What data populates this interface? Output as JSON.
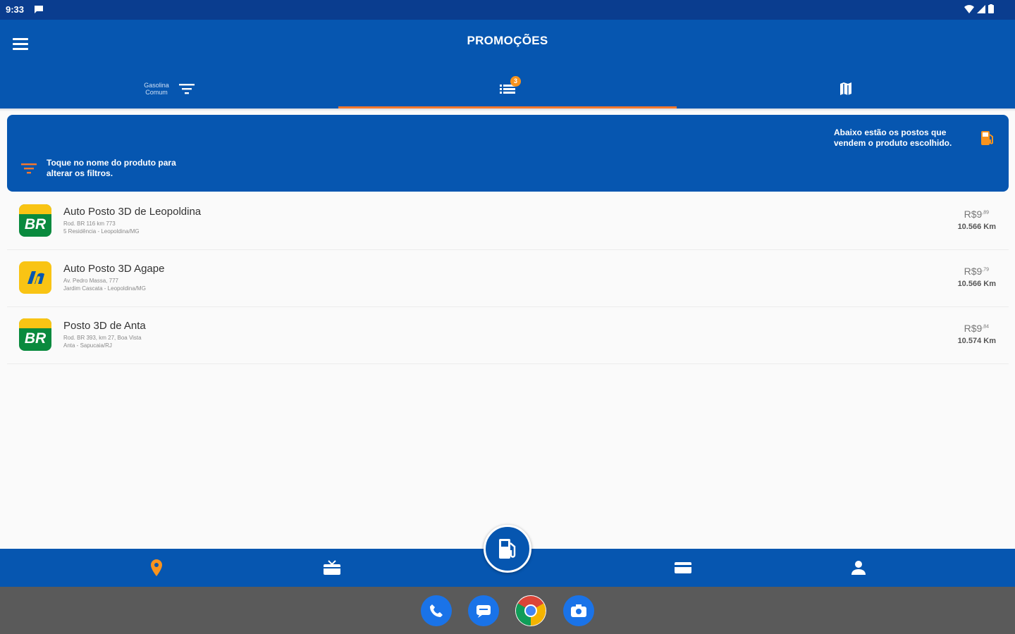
{
  "statusbar": {
    "time": "9:33"
  },
  "appbar": {
    "title": "PROMOÇÕES"
  },
  "tabs": {
    "fuel_filter_label_1": "Gasolina",
    "fuel_filter_label_2": "Comum",
    "badge_count": "3"
  },
  "info": {
    "right_text": "Abaixo estão os postos que vendem o produto escolhido.",
    "left_text": "Toque no nome do produto para alterar os filtros."
  },
  "stations": [
    {
      "name": "Auto Posto 3D de Leopoldina",
      "addr1": "Rod. BR 116 km 773",
      "addr2": "5 Residência - Leopoldina/MG",
      "price_main": "R$9",
      "price_dec": ",89",
      "distance": "10.566 Km",
      "brand": "BR"
    },
    {
      "name": "Auto Posto 3D Agape",
      "addr1": "Av. Pedro Massa, 777",
      "addr2": "Jardim Cascata - Leopoldina/MG",
      "price_main": "R$9",
      "price_dec": ",79",
      "distance": "10.566 Km",
      "brand": "Ipiranga"
    },
    {
      "name": "Posto 3D de Anta",
      "addr1": "Rod. BR 393, km 27, Boa Vista",
      "addr2": "Anta - Sapucaia/RJ",
      "price_main": "R$9",
      "price_dec": ",84",
      "distance": "10.574 Km",
      "brand": "BR"
    }
  ],
  "colors": {
    "primary": "#0656b0",
    "accent": "#f7782d",
    "statusbar": "#0a3d8f",
    "dock": "#5a5a5a"
  },
  "icons": {
    "menu": "hamburger-icon",
    "filter": "filter-icon",
    "list": "list-icon",
    "map": "map-icon",
    "location": "location-pin-icon",
    "gift": "gift-icon",
    "card": "card-icon",
    "profile": "person-icon",
    "fuel_pump": "fuel-pump-icon"
  }
}
